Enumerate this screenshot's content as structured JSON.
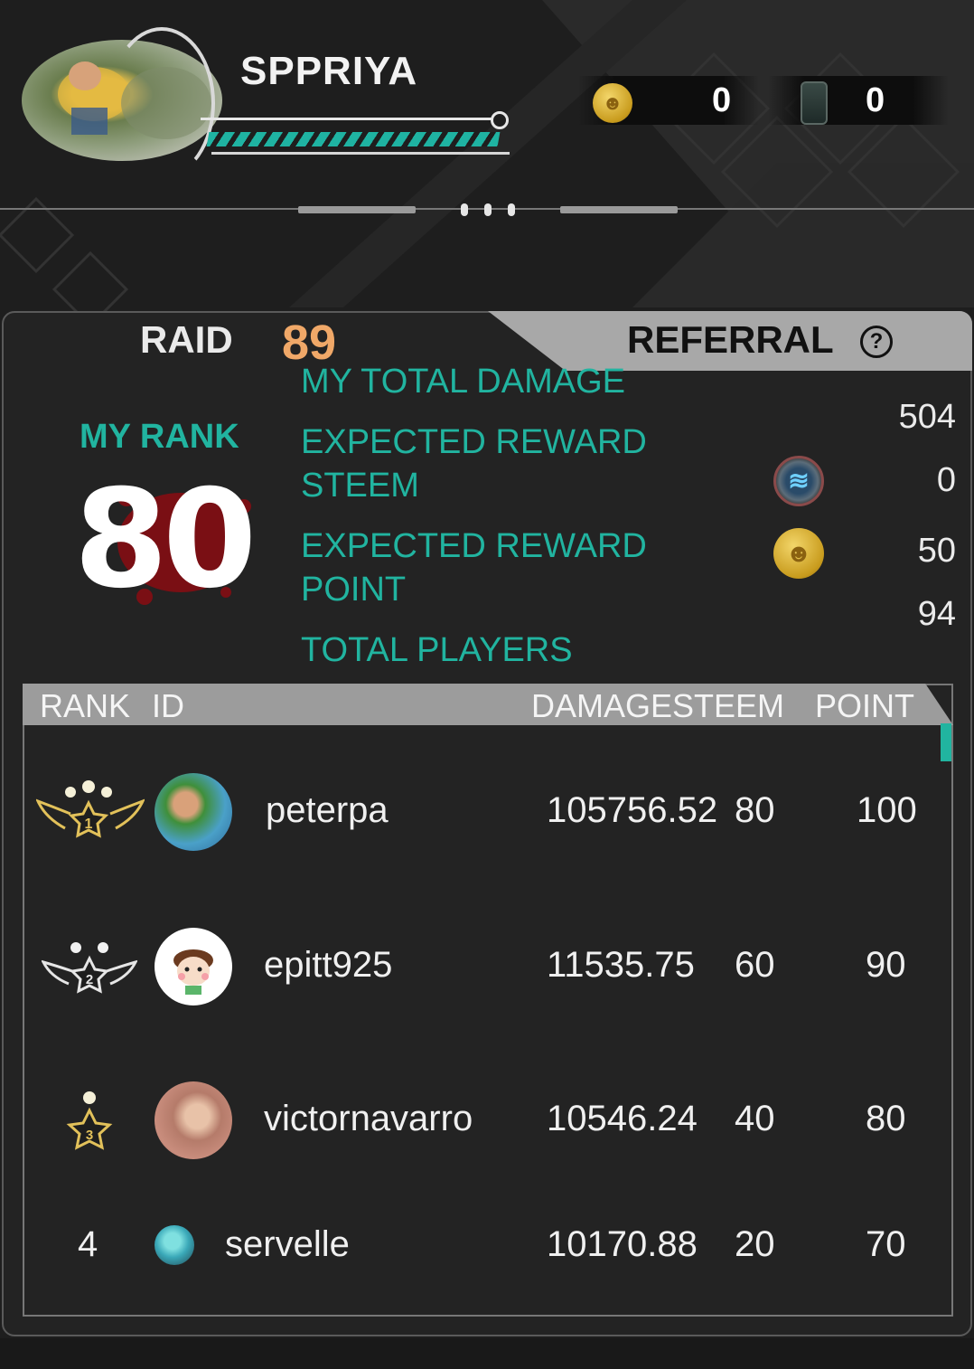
{
  "header": {
    "player_name": "SPPRIYA",
    "coin_balance": "0",
    "ticket_balance": "0"
  },
  "tabs": {
    "raid_label": "RAID",
    "raid_number": "89",
    "referral_label": "REFERRAL",
    "help_symbol": "?"
  },
  "my_rank": {
    "label": "MY RANK",
    "value": "80"
  },
  "stats": {
    "total_damage_label": "MY TOTAL DAMAGE",
    "total_damage_value": "504",
    "reward_steem_label_line1": "EXPECTED REWARD",
    "reward_steem_label_line2": "STEEM",
    "reward_steem_value": "0",
    "reward_point_label_line1": "EXPECTED REWARD",
    "reward_point_label_line2": "POINT",
    "reward_point_value": "50",
    "total_players_label": "TOTAL PLAYERS",
    "total_players_value": "94"
  },
  "table": {
    "headers": {
      "rank": "RANK",
      "id": "ID",
      "damage": "DAMAGE",
      "steem": "STEEM",
      "point": "POINT"
    },
    "rows": [
      {
        "rank": "1",
        "id": "peterpa",
        "damage": "105756.52",
        "steem": "80",
        "point": "100"
      },
      {
        "rank": "2",
        "id": "epitt925",
        "damage": "11535.75",
        "steem": "60",
        "point": "90"
      },
      {
        "rank": "3",
        "id": "victornavarro",
        "damage": "10546.24",
        "steem": "40",
        "point": "80"
      },
      {
        "rank": "4",
        "id": "servelle",
        "damage": "10170.88",
        "steem": "20",
        "point": "70"
      }
    ]
  },
  "icons": {
    "coin": "coin-icon",
    "ticket": "ticket-icon",
    "steem": "steem-icon",
    "help": "help-icon",
    "rank_badges": [
      "rank-1-badge-icon",
      "rank-2-badge-icon",
      "rank-3-badge-icon"
    ]
  },
  "colors": {
    "accent_teal": "#21b4a0",
    "raid_number_orange": "#f0a868",
    "gold": "#e2c15a",
    "panel_bg": "#232323"
  }
}
